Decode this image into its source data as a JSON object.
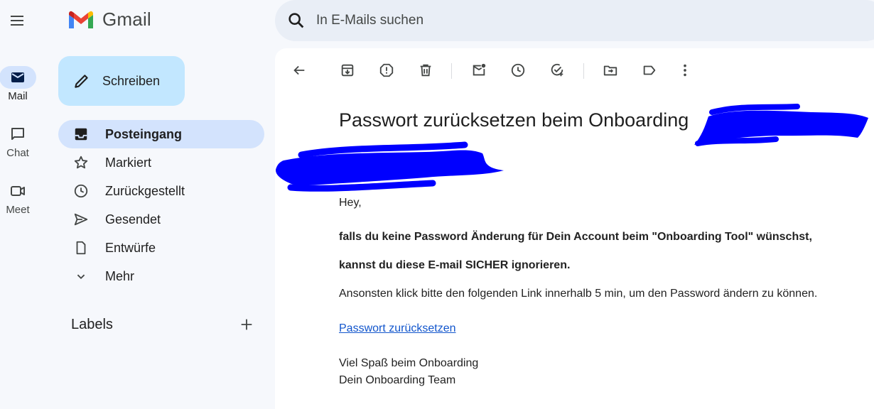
{
  "app": {
    "name": "Gmail"
  },
  "rail": {
    "items": [
      {
        "label": "Mail",
        "icon": "mail-icon"
      },
      {
        "label": "Chat",
        "icon": "chat-icon"
      },
      {
        "label": "Meet",
        "icon": "video-icon"
      }
    ]
  },
  "sidebar": {
    "compose_label": "Schreiben",
    "nav": [
      {
        "label": "Posteingang",
        "icon": "inbox-icon"
      },
      {
        "label": "Markiert",
        "icon": "star-icon"
      },
      {
        "label": "Zurückgestellt",
        "icon": "clock-icon"
      },
      {
        "label": "Gesendet",
        "icon": "send-icon"
      },
      {
        "label": "Entwürfe",
        "icon": "draft-icon"
      },
      {
        "label": "Mehr",
        "icon": "chevron-down-icon"
      }
    ],
    "labels_title": "Labels"
  },
  "search": {
    "placeholder": "In E-Mails suchen"
  },
  "email": {
    "subject": "Passwort zurücksetzen beim Onboarding",
    "greeting": "Hey,",
    "line1": "falls du keine Password Änderung für Dein Account beim \"Onboarding Tool\" wünschst,",
    "line2": "kannst du diese E-mail SICHER ignorieren.",
    "line3": "Ansonsten klick bitte den folgenden Link innerhalb 5 min, um den Password ändern zu können.",
    "link": "Passwort zurücksetzen",
    "sign1": "Viel Spaß beim Onboarding",
    "sign2": "Dein Onboarding Team"
  },
  "colors": {
    "accent": "#0b57d0",
    "compose_bg": "#c2e7ff",
    "active_bg": "#d3e3fd",
    "redaction": "#0000ff"
  }
}
